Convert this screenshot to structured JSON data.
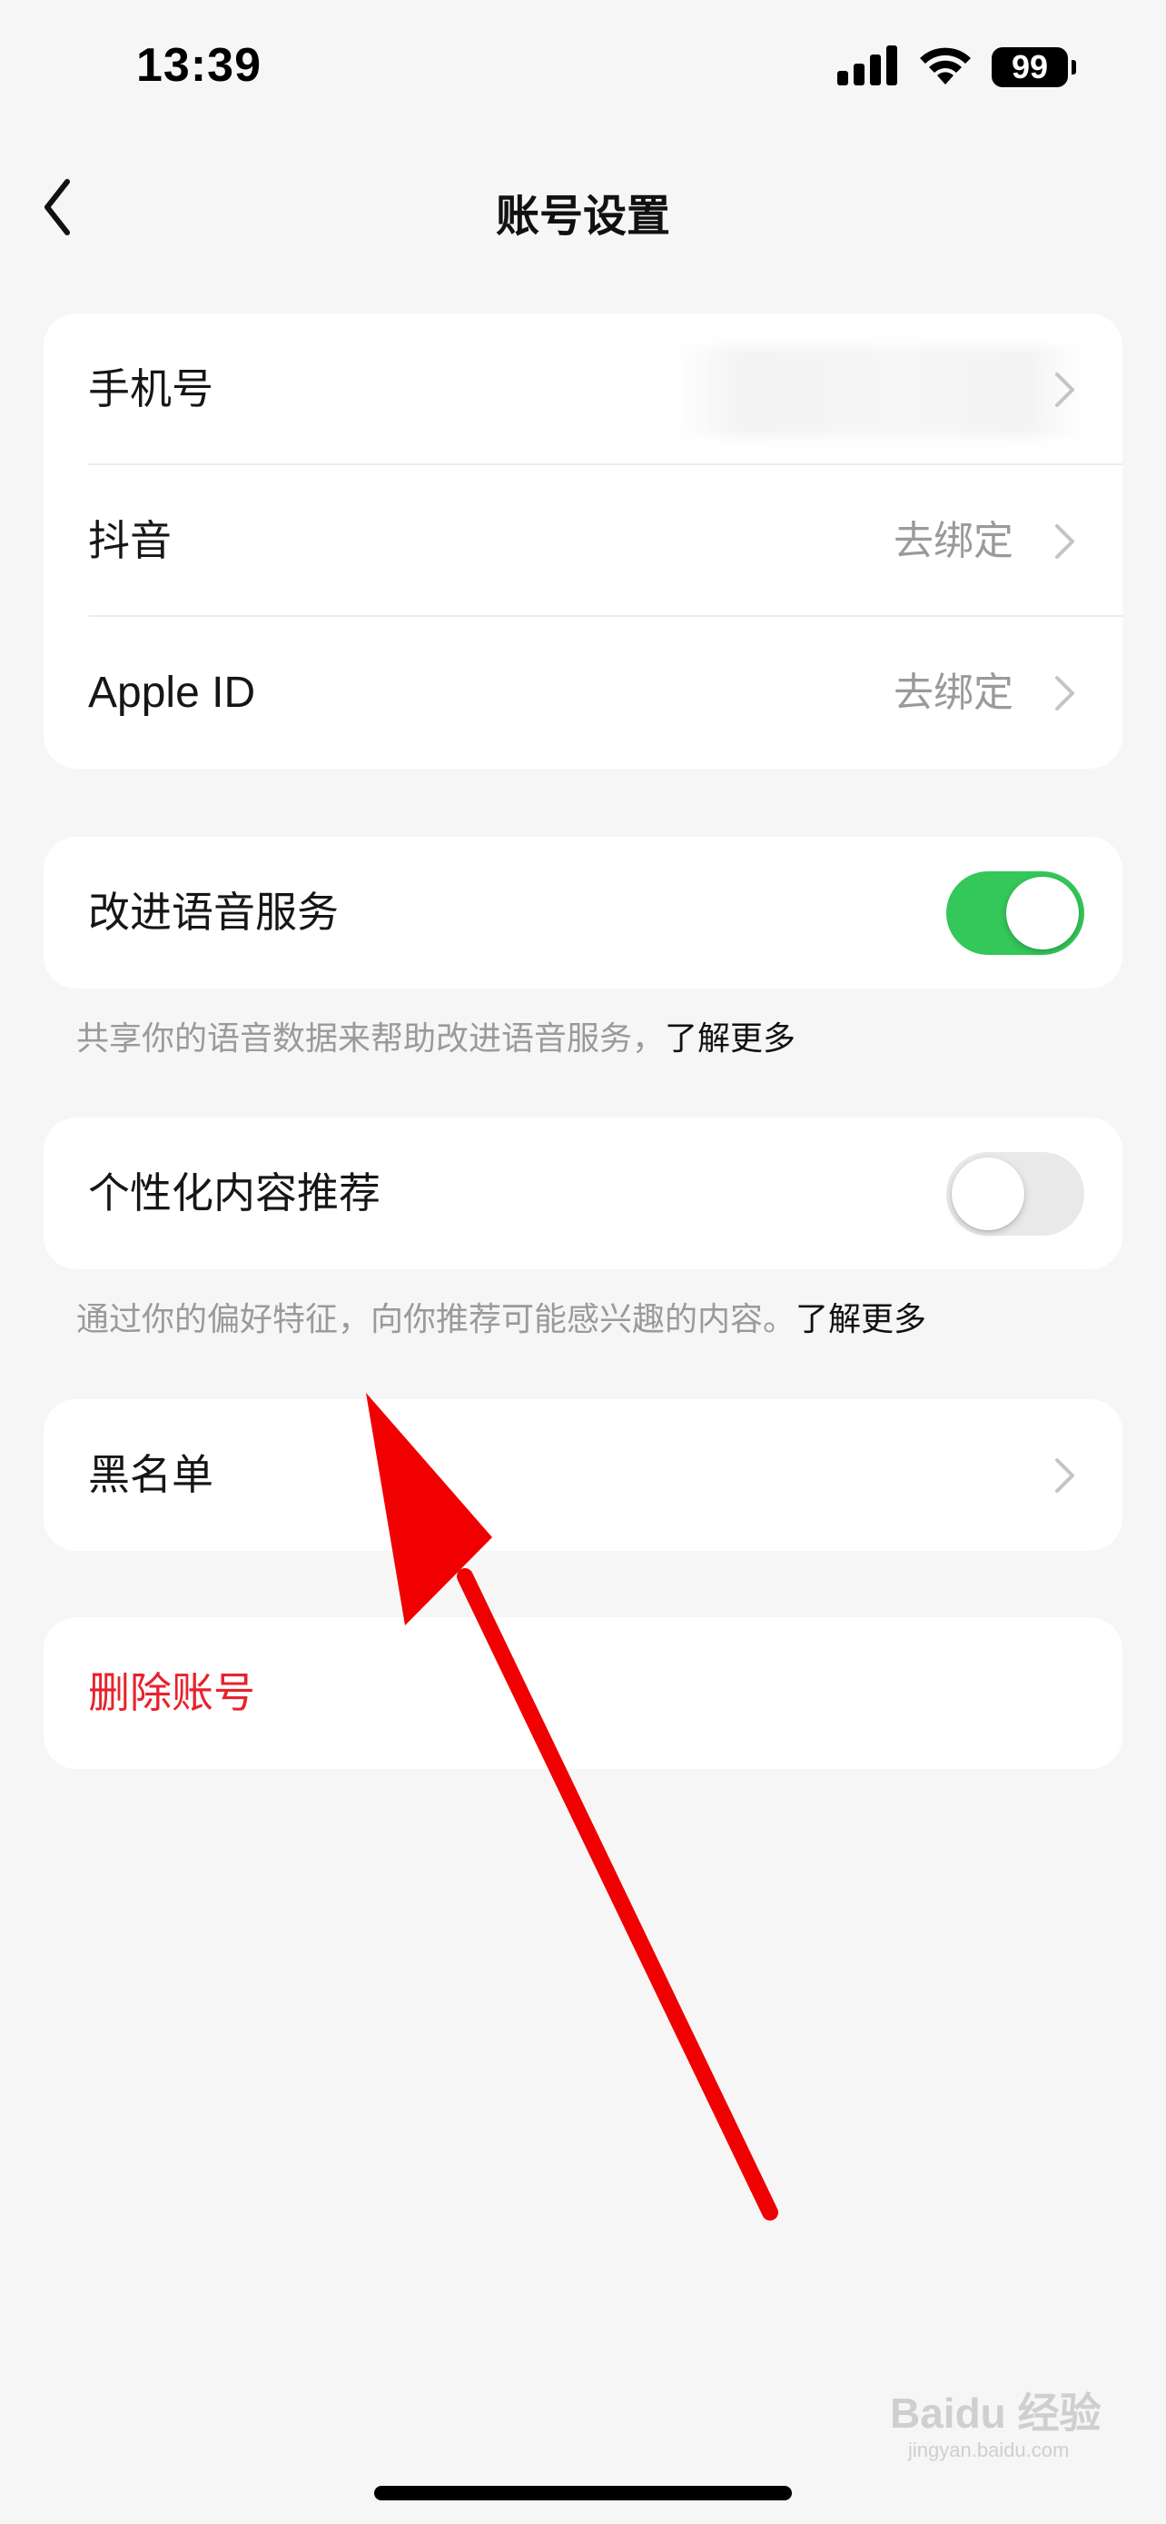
{
  "status_bar": {
    "time": "13:39",
    "battery": "99"
  },
  "nav": {
    "title": "账号设置"
  },
  "account_section": {
    "rows": [
      {
        "label": "手机号",
        "value": ""
      },
      {
        "label": "抖音",
        "value": "去绑定"
      },
      {
        "label": "Apple ID",
        "value": "去绑定"
      }
    ]
  },
  "voice_service": {
    "label": "改进语音服务",
    "enabled": true,
    "footnote": "共享你的语音数据来帮助改进语音服务，",
    "learn_more": "了解更多"
  },
  "personalized_content": {
    "label": "个性化内容推荐",
    "enabled": false,
    "footnote": "通过你的偏好特征，向你推荐可能感兴趣的内容。",
    "learn_more": "了解更多"
  },
  "blacklist": {
    "label": "黑名单"
  },
  "delete_account": {
    "label": "删除账号",
    "color": "#e8222c"
  },
  "colors": {
    "toggle_on": "#34c759",
    "annotation_arrow": "#f00000"
  },
  "watermark": {
    "brand": "Baidu 经验",
    "url": "jingyan.baidu.com"
  }
}
